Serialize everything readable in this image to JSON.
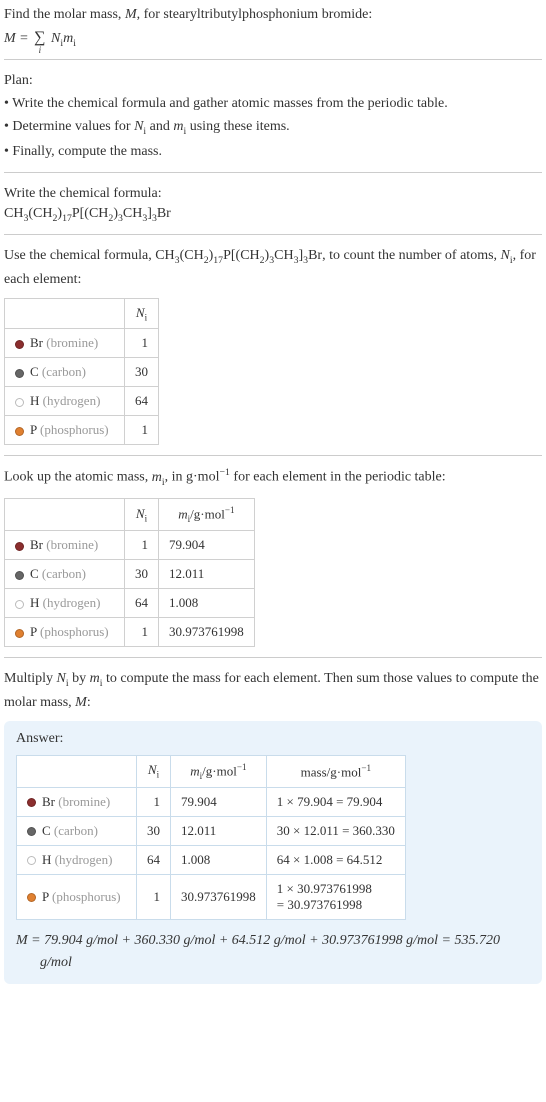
{
  "intro": {
    "line1": "Find the molar mass, M, for stearyltributylphosphonium bromide:",
    "formula": "M = ∑ Nᵢmᵢ",
    "m_eq_label": "M",
    "equals": " = ",
    "n_label": "N",
    "i_label": "i",
    "mi_label": "m"
  },
  "plan": {
    "heading": "Plan:",
    "bullet1": "• Write the chemical formula and gather atomic masses from the periodic table.",
    "bullet2_pre": "• Determine values for ",
    "bullet2_mid": " and ",
    "bullet2_post": " using these items.",
    "bullet3": "• Finally, compute the mass."
  },
  "step1": {
    "heading": "Write the chemical formula:",
    "formula_parts": {
      "p1": "CH",
      "s1": "3",
      "p2": "(CH",
      "s2": "2",
      "p3": ")",
      "s3": "17",
      "p4": "P[(CH",
      "s4": "2",
      "p5": ")",
      "s5": "3",
      "p6": "CH",
      "s6": "3",
      "p7": "]",
      "s7": "3",
      "p8": "Br"
    }
  },
  "step2": {
    "text_pre": "Use the chemical formula, ",
    "text_post": ", to count the number of atoms, ",
    "text_end": ", for each element:",
    "header_ni": "N",
    "header_i": "i"
  },
  "elements": {
    "br": {
      "sym": "Br",
      "name": " (bromine)"
    },
    "c": {
      "sym": "C",
      "name": " (carbon)"
    },
    "h": {
      "sym": "H",
      "name": " (hydrogen)"
    },
    "p": {
      "sym": "P",
      "name": " (phosphorus)"
    }
  },
  "table1": {
    "br": "1",
    "c": "30",
    "h": "64",
    "p": "1"
  },
  "step3": {
    "text_pre": "Look up the atomic mass, ",
    "text_mid": ", in g·mol",
    "text_exp": "−1",
    "text_post": " for each element in the periodic table:",
    "header_mi_pre": "m",
    "header_mi_unit": "/g·mol",
    "header_mi_exp": "−1"
  },
  "table2": {
    "br_n": "1",
    "br_m": "79.904",
    "c_n": "30",
    "c_m": "12.011",
    "h_n": "64",
    "h_m": "1.008",
    "p_n": "1",
    "p_m": "30.973761998"
  },
  "step4": {
    "text_pre": "Multiply ",
    "text_mid": " by ",
    "text_post": " to compute the mass for each element. Then sum those values to compute the molar mass, ",
    "text_end": ":"
  },
  "answer": {
    "heading": "Answer:",
    "header_mass_pre": "mass/g·mol",
    "header_mass_exp": "−1",
    "br_mass": "1 × 79.904 = 79.904",
    "c_mass": "30 × 12.011 = 360.330",
    "h_mass": "64 × 1.008 = 64.512",
    "p_mass_l1": "1 × 30.973761998",
    "p_mass_l2": "= 30.973761998",
    "final": "M = 79.904 g/mol + 360.330 g/mol + 64.512 g/mol + 30.973761998 g/mol = 535.720 g/mol"
  },
  "M_var": "M"
}
